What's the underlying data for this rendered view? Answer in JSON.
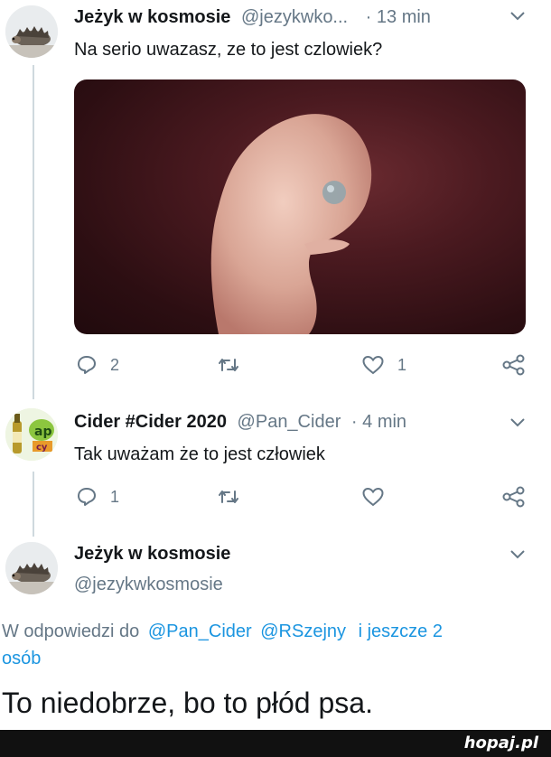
{
  "tweet1": {
    "display_name": "Jeżyk w kosmosie",
    "handle": "@jezykwko...",
    "time": "· 13 min",
    "text": "Na serio uwazasz, ze to jest czlowiek?",
    "avatar_icon": "hedgehog-avatar",
    "media_icon": "embryo-photo",
    "actions": {
      "reply_count": "2",
      "retweet_count": "",
      "like_count": "1"
    }
  },
  "tweet2": {
    "display_name": "Cider #Cider 2020",
    "handle": "@Pan_Cider",
    "time": "· 4 min",
    "text": "Tak uważam że to jest człowiek",
    "avatar_icon": "cider-bottle-avatar",
    "actions": {
      "reply_count": "1",
      "retweet_count": "",
      "like_count": ""
    }
  },
  "tweet3": {
    "display_name": "Jeżyk w kosmosie",
    "handle": "@jezykwkosmosie",
    "avatar_icon": "hedgehog-avatar",
    "reply_prefix": "W odpowiedzi do",
    "reply_mention1": "@Pan_Cider",
    "reply_mention2": "@RSzejny",
    "reply_more_line1": "i jeszcze 2",
    "reply_more_line2": "osób",
    "text": "To niedobrze, bo to płód psa."
  },
  "footer": {
    "brand": "hopaj.pl"
  },
  "colors": {
    "accent": "#1b95e0",
    "muted": "#657786",
    "thread_line": "#cfd9de"
  }
}
